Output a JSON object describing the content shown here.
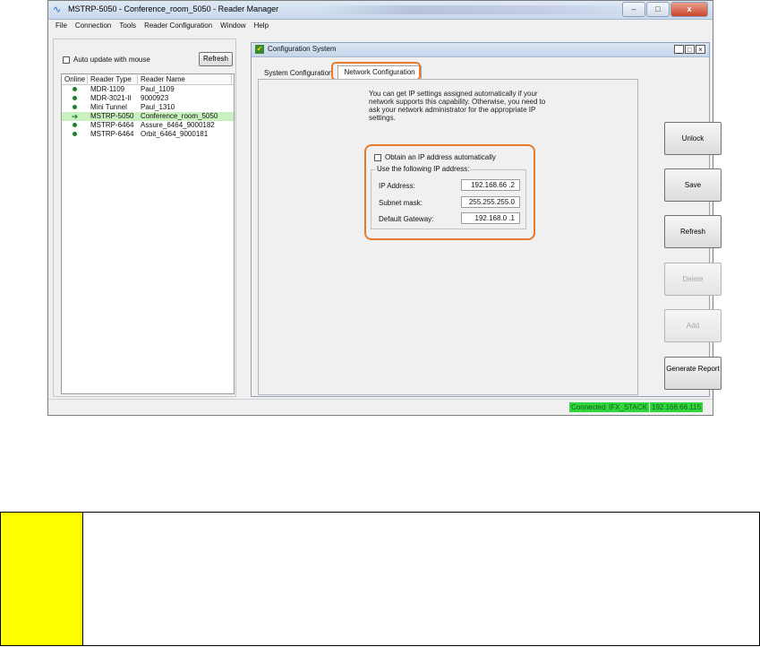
{
  "window": {
    "title": "MSTRP-5050 - Conference_room_5050 - Reader Manager",
    "minimize": "–",
    "maximize": "□",
    "close": "x"
  },
  "menu": [
    "File",
    "Connection",
    "Tools",
    "Reader Configuration",
    "Window",
    "Help"
  ],
  "left_pane": {
    "auto_update_label": "Auto update with mouse",
    "refresh_label": "Refresh",
    "columns": [
      "Online",
      "Reader Type",
      "Reader Name"
    ],
    "readers": [
      {
        "status": "online",
        "type": "MDR-1109",
        "name": "Paul_1109",
        "selected": false
      },
      {
        "status": "online",
        "type": "MDR-3021-II",
        "name": "9000923",
        "selected": false
      },
      {
        "status": "online",
        "type": "Mini Tunnel",
        "name": "Paul_1310",
        "selected": false
      },
      {
        "status": "current",
        "type": "MSTRP-5050",
        "name": "Conference_room_5050",
        "selected": true
      },
      {
        "status": "online",
        "type": "MSTRP-6464",
        "name": "Assure_6464_9000182",
        "selected": false
      },
      {
        "status": "online",
        "type": "MSTRP-6464",
        "name": "Orbit_6464_9000181",
        "selected": false
      }
    ]
  },
  "config_window": {
    "title": "Configuration System",
    "btn_min": "_",
    "btn_max": "□",
    "btn_close": "×",
    "tabs": [
      {
        "label": "System Configuration",
        "active": false
      },
      {
        "label": "Network Configuration",
        "active": true
      }
    ],
    "info_text": "You can get IP settings assigned automatically if your network supports this capability. Otherwise, you need to ask your network administrator for the appropriate IP settings.",
    "obtain_auto_label": "Obtain an IP address automatically",
    "use_following_label": "Use the following IP address:",
    "fields": [
      {
        "label": "IP Address:",
        "value": "192.168.66 .2"
      },
      {
        "label": "Subnet mask:",
        "value": "255.255.255.0"
      },
      {
        "label": "Default Gateway:",
        "value": "192.168.0 .1"
      }
    ],
    "buttons": [
      {
        "label": "Unlock",
        "enabled": true
      },
      {
        "label": "Save",
        "enabled": true
      },
      {
        "label": "Refresh",
        "enabled": true
      },
      {
        "label": "Delete",
        "enabled": false
      },
      {
        "label": "Add",
        "enabled": false
      },
      {
        "label": "Generate Report",
        "enabled": true
      }
    ]
  },
  "status_bar": [
    "Connected",
    "IFX_STACK",
    "192.168.66.115"
  ],
  "colors": {
    "highlight_orange": "#e67b2f",
    "status_green": "#2fd53a",
    "selected_row": "#c9f1c0",
    "note_yellow": "#ffff00"
  }
}
